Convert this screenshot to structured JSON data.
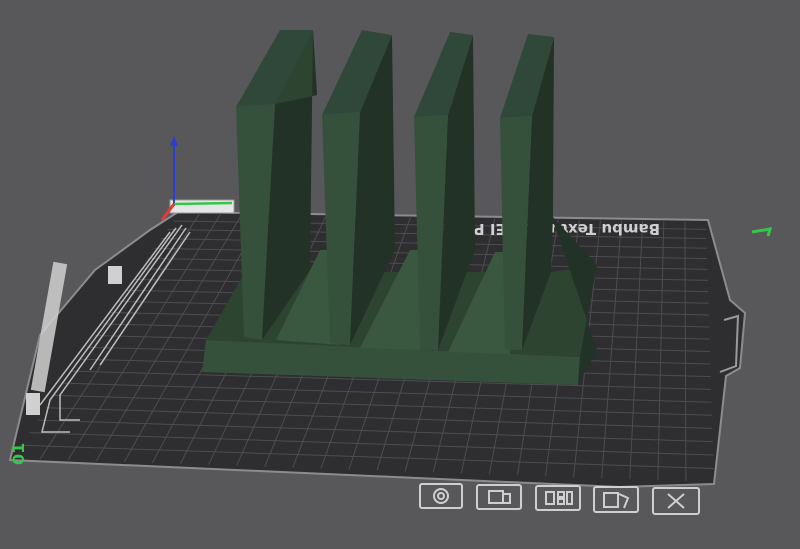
{
  "app": {
    "view": "3D prepare view",
    "plate_label": "Bambu Textured PEI Plate",
    "plate_number": "01"
  },
  "colors": {
    "background": "#58585b",
    "plate": "#2e2e31",
    "grid": "#4d4d51",
    "model_front": "#36513b",
    "model_side": "#223226",
    "model_top": "#2d4431",
    "axis_x": "#e43a3a",
    "axis_y": "#35c64a",
    "axis_z": "#2a3fd6",
    "plate_ui_outline": "#cfcfcf"
  },
  "plate_toolbar": [
    {
      "name": "orient-plate-button",
      "icon": "orient-icon"
    },
    {
      "name": "lock-plate-button",
      "icon": "lock-icon"
    },
    {
      "name": "arrange-plate-button",
      "icon": "arrange-icon"
    },
    {
      "name": "plate-settings-button",
      "icon": "plate-settings-icon"
    },
    {
      "name": "delete-plate-button",
      "icon": "close-icon"
    }
  ]
}
